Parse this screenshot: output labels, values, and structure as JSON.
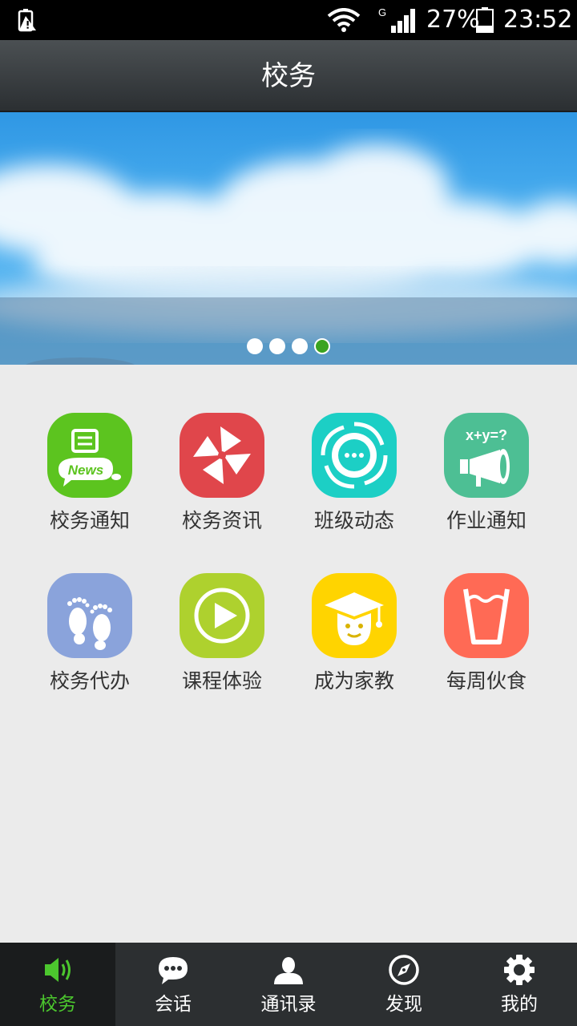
{
  "status_bar": {
    "network": "G",
    "battery": "27%",
    "time": "23:52"
  },
  "header": {
    "title": "校务"
  },
  "banner": {
    "slide_count": 4,
    "active_slide": 4
  },
  "features": [
    {
      "label": "校务通知",
      "icon": "news-icon",
      "color": "#5cc41f",
      "icon_text": "News"
    },
    {
      "label": "校务资讯",
      "icon": "pinwheel-icon",
      "color": "#e0464b"
    },
    {
      "label": "班级动态",
      "icon": "flower-chat-icon",
      "color": "#1ccfc5"
    },
    {
      "label": "作业通知",
      "icon": "megaphone-icon",
      "color": "#4dbf94",
      "icon_text": "x+y=?"
    },
    {
      "label": "校务代办",
      "icon": "footprints-icon",
      "color": "#8aa3db"
    },
    {
      "label": "课程体验",
      "icon": "play-icon",
      "color": "#aed12e"
    },
    {
      "label": "成为家教",
      "icon": "graduate-icon",
      "color": "#ffd400"
    },
    {
      "label": "每周伙食",
      "icon": "cup-icon",
      "color": "#ff6a55"
    }
  ],
  "tabs": [
    {
      "label": "校务",
      "icon": "speaker-icon",
      "active": true
    },
    {
      "label": "会话",
      "icon": "chat-bubble-icon",
      "active": false
    },
    {
      "label": "通讯录",
      "icon": "contact-icon",
      "active": false
    },
    {
      "label": "发现",
      "icon": "compass-icon",
      "active": false
    },
    {
      "label": "我的",
      "icon": "gear-icon",
      "active": false
    }
  ],
  "colors": {
    "accent_green": "#4cc72e",
    "tab_bar": "#2c2f31",
    "header": "#3a3e41"
  }
}
